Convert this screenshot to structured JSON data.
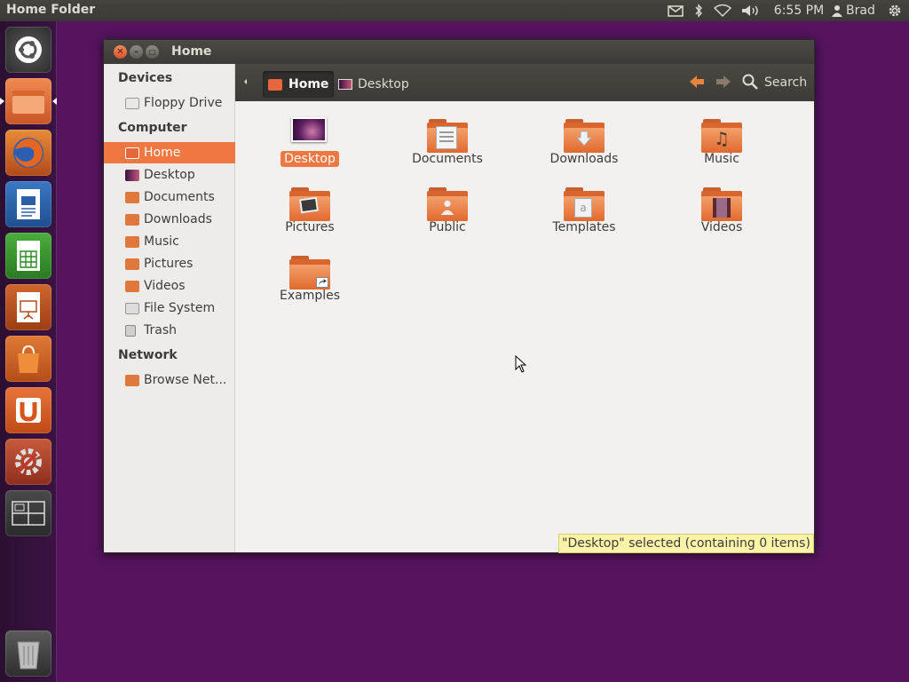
{
  "panel": {
    "title": "Home Folder",
    "time": "6:55 PM",
    "user": "Brad",
    "indicators": [
      "mail-icon",
      "bluetooth-icon",
      "wifi-icon",
      "volume-icon",
      "user-icon",
      "gear-icon"
    ]
  },
  "launcher": {
    "items": [
      "dash-home-icon",
      "files-icon",
      "firefox-icon",
      "writer-icon",
      "calc-icon",
      "impress-icon",
      "software-center-icon",
      "ubuntu-one-icon",
      "system-settings-icon",
      "workspace-switcher-icon",
      "trash-icon"
    ]
  },
  "window": {
    "title": "Home"
  },
  "sidebar": {
    "devices_heading": "Devices",
    "computer_heading": "Computer",
    "network_heading": "Network",
    "devices": [
      {
        "label": "Floppy Drive"
      }
    ],
    "computer": [
      {
        "label": "Home"
      },
      {
        "label": "Desktop"
      },
      {
        "label": "Documents"
      },
      {
        "label": "Downloads"
      },
      {
        "label": "Music"
      },
      {
        "label": "Pictures"
      },
      {
        "label": "Videos"
      },
      {
        "label": "File System"
      },
      {
        "label": "Trash"
      }
    ],
    "network": [
      {
        "label": "Browse Net..."
      }
    ]
  },
  "toolbar": {
    "crumbs": [
      "Home",
      "Desktop"
    ],
    "search_label": "Search"
  },
  "files": [
    {
      "label": "Desktop"
    },
    {
      "label": "Documents"
    },
    {
      "label": "Downloads"
    },
    {
      "label": "Music"
    },
    {
      "label": "Pictures"
    },
    {
      "label": "Public"
    },
    {
      "label": "Templates"
    },
    {
      "label": "Videos"
    },
    {
      "label": "Examples"
    }
  ],
  "status": {
    "text": "\"Desktop\" selected (containing 0 items)"
  },
  "colors": {
    "accent": "#ee7742",
    "desktop": "#56145f",
    "panel": "#3c3b37"
  }
}
